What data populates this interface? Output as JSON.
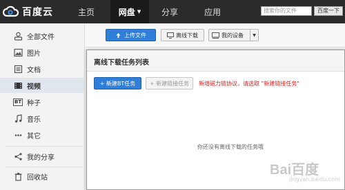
{
  "header": {
    "logo_text": "百度云",
    "nav": [
      {
        "label": "主页"
      },
      {
        "label": "网盘",
        "caret": "▼"
      },
      {
        "label": "分享"
      },
      {
        "label": "应用"
      }
    ],
    "search_placeholder": "搜索你的文件",
    "search_button": "百度一下"
  },
  "sidebar": {
    "items": [
      {
        "label": "全部文件",
        "icon": "user-icon"
      },
      {
        "label": "图片",
        "icon": "image-icon"
      },
      {
        "label": "文档",
        "icon": "document-icon"
      },
      {
        "label": "视频",
        "icon": "video-icon"
      },
      {
        "label": "种子",
        "icon": "bt-icon",
        "icon_text": "BT"
      },
      {
        "label": "音乐",
        "icon": "music-icon"
      },
      {
        "label": "其它",
        "icon": "other-icon"
      },
      {
        "label": "我的分享",
        "icon": "share-icon"
      },
      {
        "label": "回收站",
        "icon": "trash-icon"
      }
    ]
  },
  "toolbar": {
    "upload": "上传文件",
    "offline": "离线下载",
    "device": "我的设备"
  },
  "dialog": {
    "title": "离线下载任务列表",
    "new_bt": "+ 新建BT任务",
    "new_link": "+ 新建链接任务",
    "notice": "新增磁力链协议，请选取 \"新建链接任务\"",
    "empty": "你还没有离线下载的任务哦"
  },
  "watermark": {
    "text": "Bai百度",
    "sub": "jingyan.baidu.com"
  },
  "colors": {
    "topbar": "#2b2b2b",
    "primary": "#2f7ed8",
    "notice": "#e02020"
  }
}
